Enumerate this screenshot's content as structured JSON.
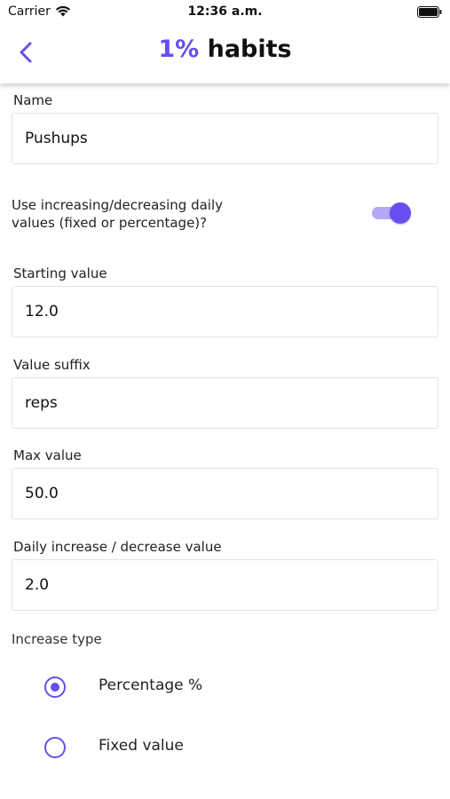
{
  "status_bar": {
    "carrier": "Carrier",
    "time": "12:36 a.m.",
    "icons": [
      "wifi-icon",
      "battery-icon"
    ]
  },
  "nav": {
    "back_icon": "chevron-left-icon",
    "title_accent": "1%",
    "title_rest": "habits",
    "accent_color": "#6a4df0"
  },
  "form": {
    "name": {
      "label": "Name",
      "value": "Pushups"
    },
    "toggle": {
      "label": "Use increasing/decreasing daily values (fixed or percentage)?",
      "on": true
    },
    "starting_value": {
      "label": "Starting value",
      "value": "12.0"
    },
    "value_suffix": {
      "label": "Value suffix",
      "value": "reps"
    },
    "max_value": {
      "label": "Max value",
      "value": "50.0"
    },
    "daily_change": {
      "label": "Daily increase / decrease value",
      "value": "2.0"
    },
    "increase_type": {
      "label": "Increase type",
      "options": [
        {
          "label": "Percentage %",
          "selected": true
        },
        {
          "label": "Fixed value",
          "selected": false
        }
      ]
    }
  }
}
